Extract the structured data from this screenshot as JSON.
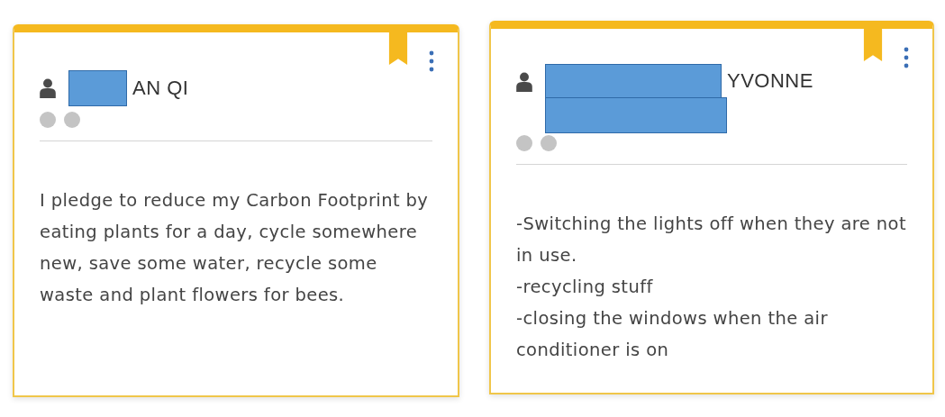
{
  "cards": [
    {
      "name": "AN QI",
      "paragraphs": [
        "I pledge to reduce my Carbon Footprint by eating plants for a day, cycle somewhere new, save some water, recycle some waste and plant flowers for bees."
      ]
    },
    {
      "name": "YVONNE",
      "paragraphs": [
        "-Switching the lights off when they are not in use.",
        "-recycling stuff",
        "-closing the windows when the air conditioner is on"
      ]
    }
  ]
}
